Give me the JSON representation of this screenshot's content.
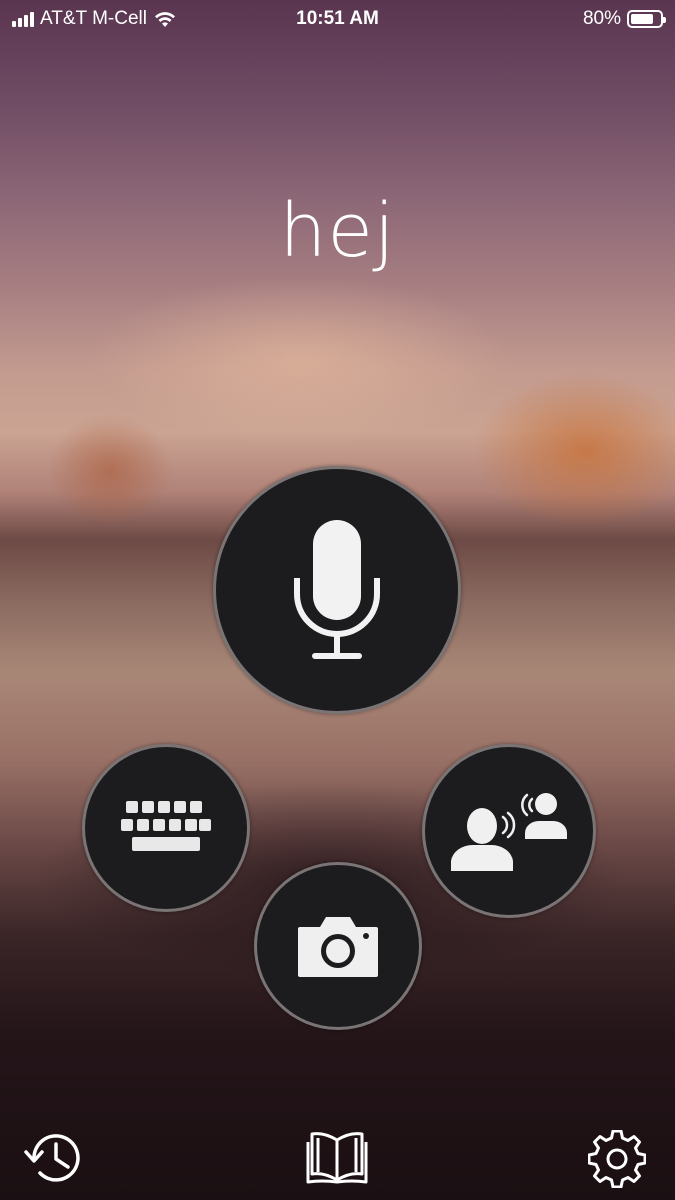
{
  "status_bar": {
    "carrier": "AT&T M-Cell",
    "time": "10:51 AM",
    "battery_percent": "80%",
    "battery_level": 0.8,
    "signal_bars": 4,
    "icons": [
      "signal-icon",
      "wifi-icon",
      "battery-icon"
    ]
  },
  "translation": {
    "phrase": "hej"
  },
  "actions": {
    "microphone": {
      "icon": "microphone-icon"
    },
    "keyboard": {
      "icon": "keyboard-icon"
    },
    "conversation": {
      "icon": "conversation-icon"
    },
    "camera": {
      "icon": "camera-icon"
    }
  },
  "toolbar": {
    "history": {
      "icon": "history-icon"
    },
    "phrasebook": {
      "icon": "book-icon"
    },
    "settings": {
      "icon": "gear-icon"
    }
  },
  "colors": {
    "button_fill": "#1c1c1e",
    "button_ring": "#c8bebe",
    "icon": "#ffffff"
  }
}
